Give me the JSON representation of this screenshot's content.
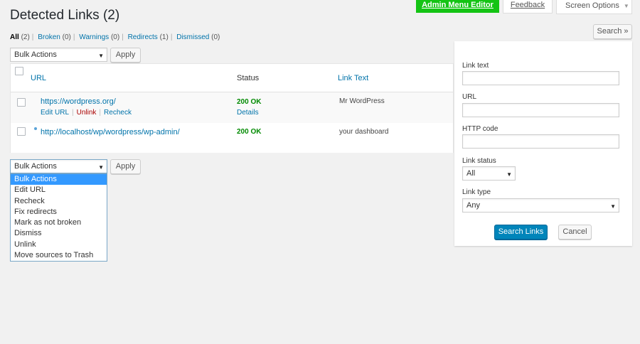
{
  "top_buttons": {
    "admin_menu_editor": "Admin Menu Editor",
    "feedback": "Feedback",
    "screen_options": "Screen Options"
  },
  "page_title": "Detected Links (2)",
  "filters": [
    {
      "label": "All",
      "count": "(2)"
    },
    {
      "label": "Broken",
      "count": "(0)"
    },
    {
      "label": "Warnings",
      "count": "(0)"
    },
    {
      "label": "Redirects",
      "count": "(1)"
    },
    {
      "label": "Dismissed",
      "count": "(0)"
    }
  ],
  "bulk_actions": {
    "selected": "Bulk Actions",
    "apply": "Apply",
    "options": [
      "Bulk Actions",
      "Edit URL",
      "Recheck",
      "Fix redirects",
      "Mark as not broken",
      "Dismiss",
      "Unlink",
      "Move sources to Trash"
    ]
  },
  "table": {
    "columns": {
      "url": "URL",
      "status": "Status",
      "link_text": "Link Text"
    },
    "rows": [
      {
        "url": "https://wordpress.org/",
        "status": "200 OK",
        "link_text": "Mr WordPress",
        "actions": {
          "edit": "Edit URL",
          "unlink": "Unlink",
          "recheck": "Recheck"
        },
        "details": "Details"
      },
      {
        "url": "http://localhost/wp/wordpress/wp-admin/",
        "status": "200 OK",
        "link_text": "your dashboard"
      }
    ]
  },
  "search_panel": {
    "toggle": "Search »",
    "link_text_label": "Link text",
    "url_label": "URL",
    "http_code_label": "HTTP code",
    "link_status_label": "Link status",
    "link_status_value": "All",
    "link_type_label": "Link type",
    "link_type_value": "Any",
    "search_button": "Search Links",
    "cancel_button": "Cancel"
  },
  "colors": {
    "admin_menu_green": "#14c414",
    "link_blue": "#0073aa",
    "status_green": "#008a00",
    "unlink_red": "#aa0000",
    "primary_button": "#0085ba",
    "dropdown_highlight": "#3399ff"
  }
}
